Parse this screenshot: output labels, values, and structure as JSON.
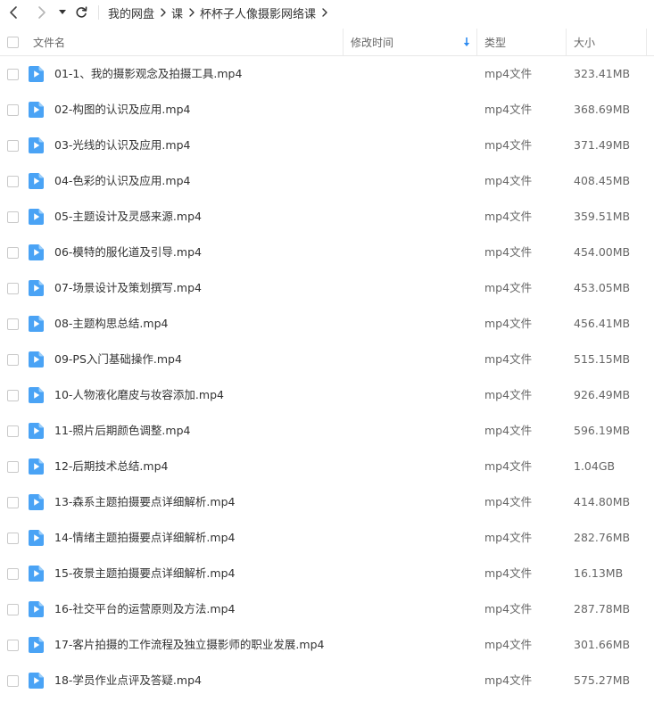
{
  "toolbar": {
    "back_icon": "chevron-left-icon",
    "forward_icon": "chevron-right-icon",
    "dropdown_icon": "caret-down-icon",
    "refresh_icon": "refresh-icon"
  },
  "breadcrumb": [
    "我的网盘",
    "课",
    "杯杯子人像摄影网络课"
  ],
  "columns": {
    "name": "文件名",
    "modified": "修改时间",
    "type": "类型",
    "size": "大小",
    "sort_icon": "arrow-down-icon"
  },
  "colors": {
    "accent": "#2e8cf0",
    "file_icon": "#4aa3f5"
  },
  "files": [
    {
      "name": "01-1、我的摄影观念及拍摄工具.mp4",
      "type": "mp4文件",
      "size": "323.41MB"
    },
    {
      "name": "02-构图的认识及应用.mp4",
      "type": "mp4文件",
      "size": "368.69MB"
    },
    {
      "name": "03-光线的认识及应用.mp4",
      "type": "mp4文件",
      "size": "371.49MB"
    },
    {
      "name": "04-色彩的认识及应用.mp4",
      "type": "mp4文件",
      "size": "408.45MB"
    },
    {
      "name": "05-主题设计及灵感来源.mp4",
      "type": "mp4文件",
      "size": "359.51MB"
    },
    {
      "name": "06-模特的服化道及引导.mp4",
      "type": "mp4文件",
      "size": "454.00MB"
    },
    {
      "name": "07-场景设计及策划撰写.mp4",
      "type": "mp4文件",
      "size": "453.05MB"
    },
    {
      "name": "08-主题构思总结.mp4",
      "type": "mp4文件",
      "size": "456.41MB"
    },
    {
      "name": "09-PS入门基础操作.mp4",
      "type": "mp4文件",
      "size": "515.15MB"
    },
    {
      "name": "10-人物液化磨皮与妆容添加.mp4",
      "type": "mp4文件",
      "size": "926.49MB"
    },
    {
      "name": "11-照片后期颜色调整.mp4",
      "type": "mp4文件",
      "size": "596.19MB"
    },
    {
      "name": "12-后期技术总结.mp4",
      "type": "mp4文件",
      "size": "1.04GB"
    },
    {
      "name": "13-森系主题拍摄要点详细解析.mp4",
      "type": "mp4文件",
      "size": "414.80MB"
    },
    {
      "name": "14-情绪主题拍摄要点详细解析.mp4",
      "type": "mp4文件",
      "size": "282.76MB"
    },
    {
      "name": "15-夜景主题拍摄要点详细解析.mp4",
      "type": "mp4文件",
      "size": "16.13MB"
    },
    {
      "name": "16-社交平台的运营原则及方法.mp4",
      "type": "mp4文件",
      "size": "287.78MB"
    },
    {
      "name": "17-客片拍摄的工作流程及独立摄影师的职业发展.mp4",
      "type": "mp4文件",
      "size": "301.66MB"
    },
    {
      "name": "18-学员作业点评及答疑.mp4",
      "type": "mp4文件",
      "size": "575.27MB"
    }
  ]
}
